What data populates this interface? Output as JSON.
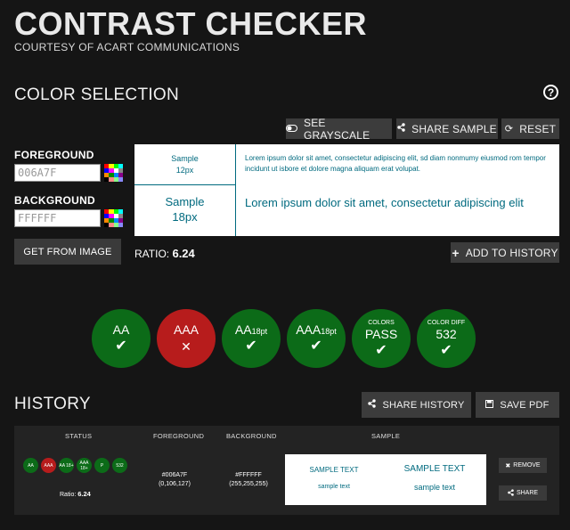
{
  "app": {
    "title": "CONTRAST CHECKER",
    "subtitle": "COURTESY OF ACART COMMUNICATIONS"
  },
  "color_selection": {
    "title": "COLOR SELECTION",
    "help_icon": "?",
    "toolbar": {
      "grayscale_label": "SEE GRAYSCALE",
      "share_sample_label": "SHARE SAMPLE",
      "reset_label": "RESET"
    },
    "foreground": {
      "label": "FOREGROUND",
      "value": "006A7F"
    },
    "background": {
      "label": "BACKGROUND",
      "value": "FFFFFF"
    },
    "get_from_image_label": "GET FROM IMAGE",
    "ratio_label": "RATIO:",
    "ratio_value": "6.24",
    "add_to_history_label": "ADD TO HISTORY",
    "sample": {
      "small_label_line1": "Sample",
      "small_label_line2": "12px",
      "large_label_line1": "Sample",
      "large_label_line2": "18px",
      "small_text": "Lorem ipsum dolor sit amet, consectetur adipiscing elit, sd diam nonmumy eiusmod rom tempor incidunt ut isbore et dolore magna aliquam erat volupat.",
      "large_text": "Lorem ipsum dolor sit amet, consectetur adipiscing elit"
    }
  },
  "results": [
    {
      "main": "AA",
      "sub": "",
      "top": "",
      "symbol": "✔",
      "status": "pass"
    },
    {
      "main": "AAA",
      "sub": "",
      "top": "",
      "symbol": "✕",
      "status": "fail"
    },
    {
      "main": "AA",
      "sub": "18pt",
      "top": "",
      "symbol": "✔",
      "status": "pass"
    },
    {
      "main": "AAA",
      "sub": "18pt",
      "top": "",
      "symbol": "✔",
      "status": "pass"
    },
    {
      "main": "PASS",
      "sub": "",
      "top": "COLORS",
      "symbol": "✔",
      "status": "pass"
    },
    {
      "main": "532",
      "sub": "",
      "top": "COLOR DIFF",
      "symbol": "✔",
      "status": "pass"
    }
  ],
  "history": {
    "title": "HISTORY",
    "share_history_label": "SHARE HISTORY",
    "save_pdf_label": "SAVE PDF",
    "columns": {
      "status": "STATUS",
      "foreground": "FOREGROUND",
      "background": "BACKGROUND",
      "sample": "SAMPLE"
    },
    "rows": [
      {
        "dots": [
          {
            "label": "AA",
            "status": "pass"
          },
          {
            "label": "AAA",
            "status": "fail"
          },
          {
            "label": "AA 18+",
            "status": "pass"
          },
          {
            "label": "AAA 18+",
            "status": "pass"
          },
          {
            "label": "P",
            "status": "pass"
          },
          {
            "label": "532",
            "status": "pass"
          }
        ],
        "ratio_label": "Ratio:",
        "ratio_value": "6.24",
        "foreground_hex": "#006A7F",
        "foreground_rgb": "(0,106,127)",
        "background_hex": "#FFFFFF",
        "background_rgb": "(255,255,255)",
        "sample_small_upper": "SAMPLE TEXT",
        "sample_small_lower": "sample text",
        "sample_large_upper": "SAMPLE TEXT",
        "sample_large_lower": "sample text",
        "remove_label": "REMOVE",
        "share_label": "SHARE"
      }
    ]
  },
  "colors": {
    "background": "#151515",
    "button": "#3c3c3c",
    "pass": "#0c6b18",
    "fail": "#b71c1c",
    "foreground_sample": "#006a7f"
  },
  "icons": {
    "grayscale": "toggle-icon",
    "share": "share-icon",
    "reset": "refresh-icon",
    "add": "plus-icon",
    "save": "floppy-disk-icon",
    "remove": "close-icon",
    "help": "question-mark-icon"
  }
}
